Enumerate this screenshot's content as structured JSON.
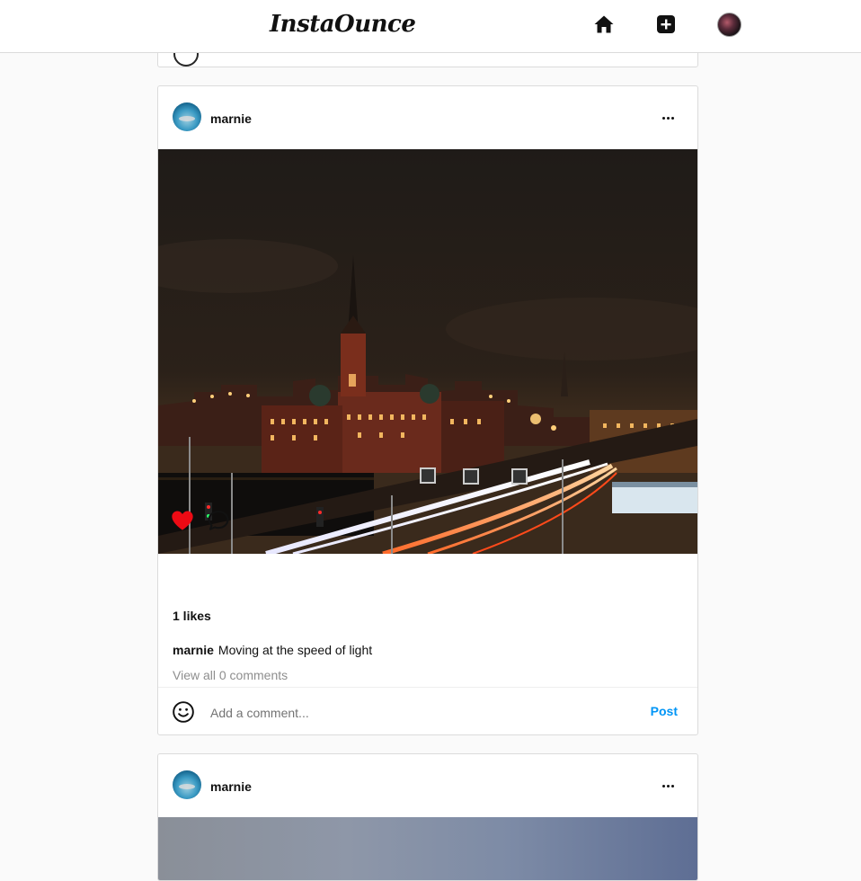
{
  "app": {
    "logo": "InstaOunce"
  },
  "nav": {
    "icons": [
      "home-icon",
      "new-post-icon",
      "profile-avatar"
    ]
  },
  "posts": [
    {
      "username": "marnie",
      "image_alt": "Night city skyline with church spire and light trails",
      "liked": true,
      "likes_text": "1 likes",
      "caption_user": "marnie",
      "caption_text": "Moving at the speed of light",
      "view_comments": "View all 0 comments",
      "comment_placeholder": "Add a comment...",
      "post_label": "Post"
    },
    {
      "username": "marnie"
    }
  ],
  "colors": {
    "like_red": "#ed4956",
    "post_blue": "#0095f6",
    "border": "#dbdbdb",
    "background": "#fafafa"
  }
}
